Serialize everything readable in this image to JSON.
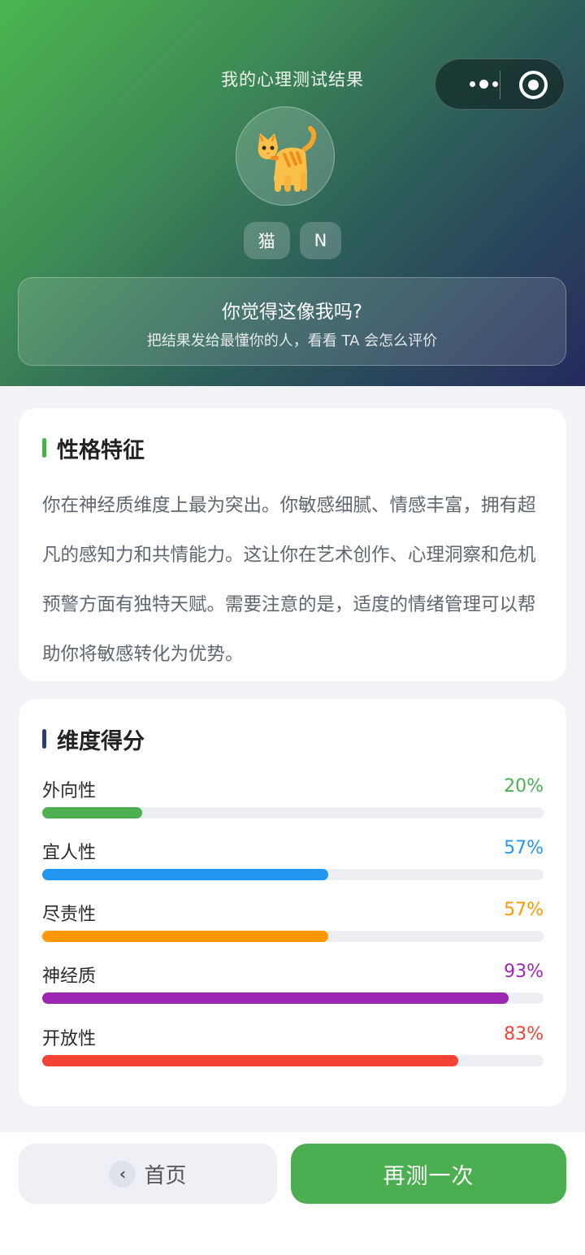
{
  "header": {
    "title": "我的心理测试结果",
    "tags": [
      "猫",
      "N"
    ],
    "share_question": "你觉得这像我吗?",
    "share_subtitle": "把结果发给最懂你的人，看看 TA 会怎么评价"
  },
  "traits": {
    "title": "性格特征",
    "accent": "#4bae50",
    "text": "你在神经质维度上最为突出。你敏感细腻、情感丰富，拥有超凡的感知力和共情能力。这让你在艺术创作、心理洞察和危机预警方面有独特天赋。需要注意的是，适度的情绪管理可以帮助你将敏感转化为优势。"
  },
  "scores": {
    "title": "维度得分",
    "accent": "#2f3c6e",
    "items": [
      {
        "name": "外向性",
        "percent": "20%",
        "value": 20,
        "color": "#4caf50"
      },
      {
        "name": "宜人性",
        "percent": "57%",
        "value": 57,
        "color": "#2196f3"
      },
      {
        "name": "尽责性",
        "percent": "57%",
        "value": 57,
        "color": "#ff9800"
      },
      {
        "name": "神经质",
        "percent": "93%",
        "value": 93,
        "color": "#9c27b0"
      },
      {
        "name": "开放性",
        "percent": "83%",
        "value": 83,
        "color": "#f44336"
      }
    ]
  },
  "footer": {
    "home_label": "首页",
    "retry_label": "再测一次"
  },
  "icons": {
    "avatar": "cat-icon",
    "capsule_more": "more-dots-icon",
    "capsule_close": "target-icon",
    "home": "chevron-left-icon"
  }
}
